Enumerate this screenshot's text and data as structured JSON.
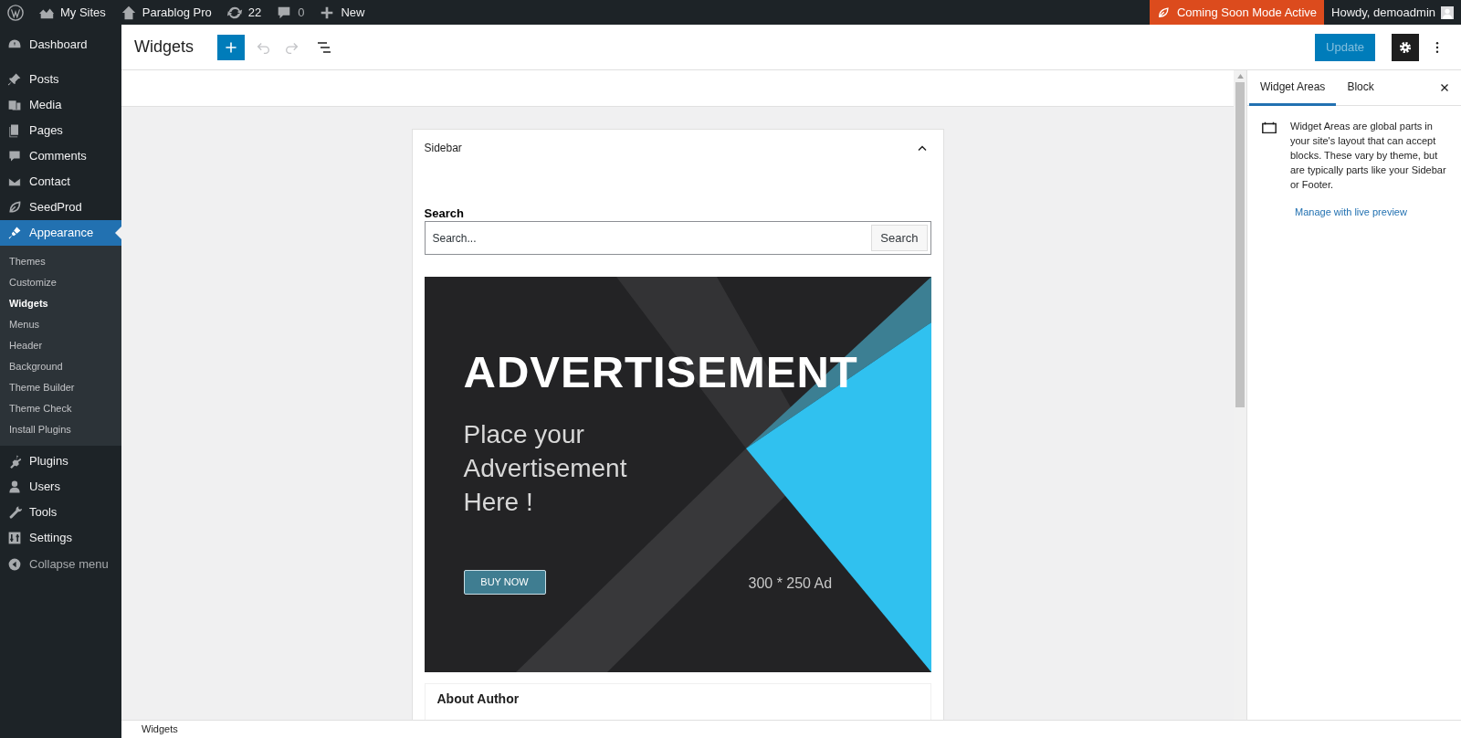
{
  "admin_bar": {
    "left": [
      {
        "kind": "logo"
      },
      {
        "kind": "sites",
        "label": "My Sites"
      },
      {
        "kind": "home",
        "label": "Parablog Pro"
      },
      {
        "kind": "updates",
        "label": "22"
      },
      {
        "kind": "comments",
        "label": "0"
      },
      {
        "kind": "new",
        "label": "New"
      }
    ],
    "notice": "Coming Soon Mode Active",
    "greeting": "Howdy, demoadmin"
  },
  "sidebar": {
    "items": [
      {
        "kind": "dashboard",
        "label": "Dashboard",
        "selected": false
      },
      {
        "kind": "posts",
        "label": "Posts",
        "selected": false
      },
      {
        "kind": "media",
        "label": "Media",
        "selected": false
      },
      {
        "kind": "pages",
        "label": "Pages",
        "selected": false
      },
      {
        "kind": "comments",
        "label": "Comments",
        "selected": false
      },
      {
        "kind": "contact",
        "label": "Contact",
        "selected": false
      },
      {
        "kind": "seedprod",
        "label": "SeedProd",
        "selected": false
      },
      {
        "kind": "appearance",
        "label": "Appearance",
        "selected": true,
        "children": [
          {
            "label": "Themes",
            "selected": false
          },
          {
            "label": "Customize",
            "selected": false
          },
          {
            "label": "Widgets",
            "selected": true
          },
          {
            "label": "Menus",
            "selected": false
          },
          {
            "label": "Header",
            "selected": false
          },
          {
            "label": "Background",
            "selected": false
          },
          {
            "label": "Theme Builder",
            "selected": false
          },
          {
            "label": "Theme Check",
            "selected": false
          },
          {
            "label": "Install Plugins",
            "selected": false
          }
        ]
      },
      {
        "kind": "plugins",
        "label": "Plugins",
        "selected": false
      },
      {
        "kind": "users",
        "label": "Users",
        "selected": false
      },
      {
        "kind": "tools",
        "label": "Tools",
        "selected": false
      },
      {
        "kind": "settings",
        "label": "Settings",
        "selected": false
      },
      {
        "kind": "collapse",
        "label": "Collapse menu",
        "selected": false
      }
    ]
  },
  "header": {
    "title": "Widgets",
    "undo_disabled": true,
    "redo_disabled": true,
    "update": {
      "label": "Update",
      "disabled": true
    },
    "settings_pressed": true
  },
  "canvas": {
    "area": {
      "title": "Sidebar",
      "expanded": true,
      "search": {
        "label": "Search",
        "placeholder": "Search...",
        "button": "Search"
      },
      "ad": {
        "headline": "ADVERTISEMENT",
        "text": "Place your Advertisement Here !",
        "button": "BUY NOW",
        "size": "300 * 250 Ad"
      },
      "next_block": "About Author"
    }
  },
  "panel": {
    "tabs": [
      {
        "label": "Widget Areas",
        "selected": true
      },
      {
        "label": "Block",
        "selected": false
      }
    ],
    "description": "Widget Areas are global parts in your site's layout that can accept blocks. These vary by theme, but are typically parts like your Sidebar or Footer.",
    "link": "Manage with live preview"
  },
  "footer": {
    "breadcrumb": "Widgets"
  }
}
